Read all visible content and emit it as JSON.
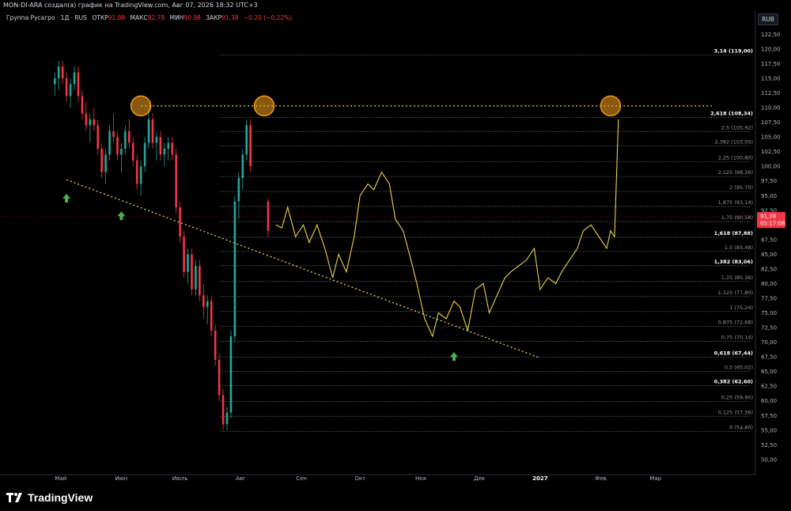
{
  "header": {
    "attribution": "MON-DI-ARA создал(а) график на TradingView.com, Авг 07, 2026 18:32 UTC+3",
    "symbol": "Группа Русагро · 1Д · RUS",
    "open_label": "ОТКР",
    "open_value": "91,88",
    "high_label": "МАКС",
    "high_value": "92,78",
    "low_label": "МИН",
    "low_value": "90,98",
    "close_label": "ЗАКР",
    "close_value": "91,38",
    "change": "−0,20 (−0,22%)",
    "currency_button": "RUB"
  },
  "footer": {
    "brand": "TradingView"
  },
  "colors": {
    "up": "#26a69a",
    "down": "#f23645",
    "projection": "#e8d24a",
    "fib_line": "#5d606b",
    "circle": "#f7a21b",
    "arrow": "#4caf50"
  },
  "chart_data": {
    "type": "line",
    "title": "Группа Русагро · 1Д · RUS",
    "xlabel": "",
    "ylabel": "",
    "ylim": [
      48.5,
      123.5
    ],
    "x_tick_labels": [
      "Май",
      "Июн",
      "Июль",
      "Авг",
      "Сен",
      "Окт",
      "Ноя",
      "Дек",
      "2027",
      "Фев",
      "Мар"
    ],
    "y_tick_labels": [
      "122,50",
      "120,00",
      "117,50",
      "115,00",
      "112,50",
      "110,00",
      "107,50",
      "105,00",
      "102,50",
      "100,00",
      "97,50",
      "95,00",
      "92,50",
      "90,00",
      "87,50",
      "85,00",
      "82,50",
      "80,00",
      "77,50",
      "75,00",
      "72,50",
      "70,00",
      "67,50",
      "65,00",
      "62,50",
      "60,00",
      "57,50",
      "55,00",
      "52,50",
      "50,00"
    ],
    "y_ticks": [
      122.5,
      120,
      117.5,
      115,
      112.5,
      110,
      107.5,
      105,
      102.5,
      100,
      97.5,
      95,
      92.5,
      90,
      87.5,
      85,
      82.5,
      80,
      77.5,
      75,
      72.5,
      70,
      67.5,
      65,
      62.5,
      60,
      57.5,
      55,
      52.5,
      50
    ],
    "last_price": {
      "value": 91.38,
      "label": "91,38",
      "countdown": "05:17:08"
    },
    "fib_levels": [
      {
        "value": 119.0,
        "label": "3,14 (119,00)",
        "bold": true
      },
      {
        "value": 108.34,
        "label": "2,618 (108,34)",
        "bold": true
      },
      {
        "value": 105.92,
        "label": "2,5 (105,92)",
        "bold": false
      },
      {
        "value": 103.5,
        "label": "2,382 (103,50)",
        "bold": false
      },
      {
        "value": 100.8,
        "label": "2,25 (100,80)",
        "bold": false
      },
      {
        "value": 98.26,
        "label": "2,125 (98,26)",
        "bold": false
      },
      {
        "value": 95.7,
        "label": "2 (95,70)",
        "bold": false
      },
      {
        "value": 93.14,
        "label": "1,875 (93,14)",
        "bold": false
      },
      {
        "value": 90.58,
        "label": "1,75 (90,58)",
        "bold": false
      },
      {
        "value": 87.88,
        "label": "1,618 (87,88)",
        "bold": true
      },
      {
        "value": 85.48,
        "label": "1,5 (85,48)",
        "bold": false
      },
      {
        "value": 83.06,
        "label": "1,382 (83,06)",
        "bold": true
      },
      {
        "value": 80.36,
        "label": "1,25 (80,36)",
        "bold": false
      },
      {
        "value": 77.8,
        "label": "1,125 (77,80)",
        "bold": false
      },
      {
        "value": 75.24,
        "label": "1 (75,24)",
        "bold": false
      },
      {
        "value": 72.68,
        "label": "0,875 (72,68)",
        "bold": false
      },
      {
        "value": 70.14,
        "label": "0,75 (70,14)",
        "bold": false
      },
      {
        "value": 67.44,
        "label": "0,618 (67,44)",
        "bold": true
      },
      {
        "value": 65.02,
        "label": "0,5 (65,02)",
        "bold": false
      },
      {
        "value": 62.6,
        "label": "0,382 (62,60)",
        "bold": true
      },
      {
        "value": 59.9,
        "label": "0,25 (59,90)",
        "bold": false
      },
      {
        "value": 57.36,
        "label": "0,125 (57,36)",
        "bold": false
      },
      {
        "value": 54.8,
        "label": "0 (54,80)",
        "bold": false
      }
    ],
    "resistance_level": 110.3,
    "candles_step_days": 2,
    "candles_start_day": -3,
    "candles": [
      [
        114,
        116,
        112,
        115
      ],
      [
        115,
        118,
        113,
        117
      ],
      [
        117,
        118,
        114,
        115
      ],
      [
        115,
        116,
        111,
        112
      ],
      [
        112,
        115,
        110,
        114
      ],
      [
        114,
        117,
        113,
        116
      ],
      [
        116,
        117,
        111,
        112
      ],
      [
        112,
        113,
        108,
        109
      ],
      [
        109,
        111,
        106,
        107
      ],
      [
        107,
        109,
        104,
        108
      ],
      [
        108,
        110,
        106,
        107
      ],
      [
        107,
        108,
        102,
        103
      ],
      [
        103,
        104,
        98,
        99
      ],
      [
        99,
        103,
        97,
        102
      ],
      [
        102,
        107,
        101,
        106
      ],
      [
        106,
        109,
        104,
        105
      ],
      [
        105,
        106,
        101,
        102
      ],
      [
        102,
        104,
        99,
        103
      ],
      [
        103,
        107,
        102,
        106
      ],
      [
        106,
        108,
        103,
        104
      ],
      [
        104,
        105,
        100,
        101
      ],
      [
        101,
        102,
        96,
        97
      ],
      [
        97,
        101,
        95,
        100
      ],
      [
        100,
        105,
        99,
        104
      ],
      [
        104,
        110,
        103,
        108
      ],
      [
        108,
        109,
        103,
        104
      ],
      [
        104,
        106,
        101,
        105
      ],
      [
        105,
        106,
        101,
        102
      ],
      [
        102,
        104,
        100,
        103
      ],
      [
        103,
        105,
        101,
        104
      ],
      [
        104,
        105,
        101,
        102
      ],
      [
        102,
        103,
        92,
        93
      ],
      [
        93,
        94,
        87,
        88
      ],
      [
        88,
        89,
        81,
        82
      ],
      [
        82,
        86,
        80,
        85
      ],
      [
        85,
        86,
        78,
        79
      ],
      [
        79,
        84,
        78,
        83
      ],
      [
        83,
        84,
        77,
        78
      ],
      [
        78,
        80,
        74,
        76
      ],
      [
        76,
        78,
        73,
        77
      ],
      [
        77,
        78,
        71,
        72
      ],
      [
        72,
        73,
        66,
        67
      ],
      [
        67,
        68,
        60,
        61
      ],
      [
        61,
        62,
        55,
        56
      ],
      [
        56,
        59,
        55,
        58
      ],
      [
        58,
        72,
        57,
        71
      ],
      [
        71,
        95,
        70,
        94
      ],
      [
        94,
        99,
        91,
        98
      ],
      [
        98,
        103,
        96,
        102
      ],
      [
        102,
        108,
        101,
        107
      ],
      [
        107,
        108,
        99,
        100
      ]
    ],
    "post_gap": {
      "day": 106,
      "open": 94,
      "high": 94.5,
      "low": 88,
      "close": 89
    },
    "series": [
      {
        "name": "projection",
        "x": [
          110,
          113,
          116,
          120,
          124,
          127,
          131,
          135,
          139,
          142,
          146,
          150,
          153,
          157,
          160,
          164,
          168,
          171,
          175,
          179,
          182,
          186,
          190,
          193,
          197,
          201,
          204,
          208,
          212,
          216,
          219,
          223,
          227,
          230,
          234,
          238,
          242,
          245,
          249,
          253,
          256,
          260,
          264,
          267,
          271,
          275,
          279,
          281,
          283,
          285
        ],
        "y": [
          90,
          89.5,
          93,
          88,
          90,
          87,
          90,
          86,
          81,
          85,
          82,
          88,
          95,
          97,
          96,
          99,
          97,
          91,
          89,
          84,
          80,
          74,
          71,
          75,
          74,
          77,
          76,
          72,
          79,
          80,
          75,
          78,
          81,
          82,
          83,
          84,
          86,
          79,
          81,
          80,
          82,
          84,
          86,
          89,
          90,
          88,
          86,
          89,
          88,
          108
        ]
      }
    ],
    "annotations": {
      "circles": [
        {
          "day": 41,
          "value": 110.3
        },
        {
          "day": 104,
          "value": 110.3
        },
        {
          "day": 281,
          "value": 110.3
        }
      ],
      "arrows_up": [
        {
          "day": 3,
          "value": 94.5
        },
        {
          "day": 31,
          "value": 91.5
        },
        {
          "day": 201,
          "value": 67.5
        }
      ],
      "trendline": {
        "start_day": 3,
        "start_value": 97.7,
        "end_day": 245,
        "end_value": 67.3
      }
    },
    "x_axis": {
      "start_day": -31,
      "end_day": 355,
      "month_days": [
        0,
        31,
        61,
        92,
        123,
        153,
        184,
        214,
        245,
        276,
        304
      ]
    },
    "grid": false,
    "legend": "top-left"
  }
}
